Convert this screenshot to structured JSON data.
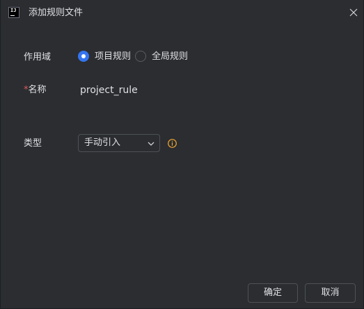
{
  "window": {
    "title": "添加规则文件"
  },
  "form": {
    "scope": {
      "label": "作用域",
      "options": [
        {
          "label": "项目规则",
          "selected": true
        },
        {
          "label": "全局规则",
          "selected": false
        }
      ]
    },
    "name": {
      "required_mark": "*",
      "label": "名称",
      "value": "project_rule"
    },
    "type": {
      "label": "类型",
      "selected": "手动引入"
    }
  },
  "buttons": {
    "ok_label": "确定",
    "cancel_label": "取消"
  },
  "colors": {
    "background": "#2b2d30",
    "accent": "#3574f0",
    "required": "#db5c5c",
    "info": "#f0a732"
  },
  "icons": {
    "app": "intellij-app-icon",
    "close": "close-icon",
    "chevron": "chevron-down-icon",
    "info": "info-icon"
  }
}
